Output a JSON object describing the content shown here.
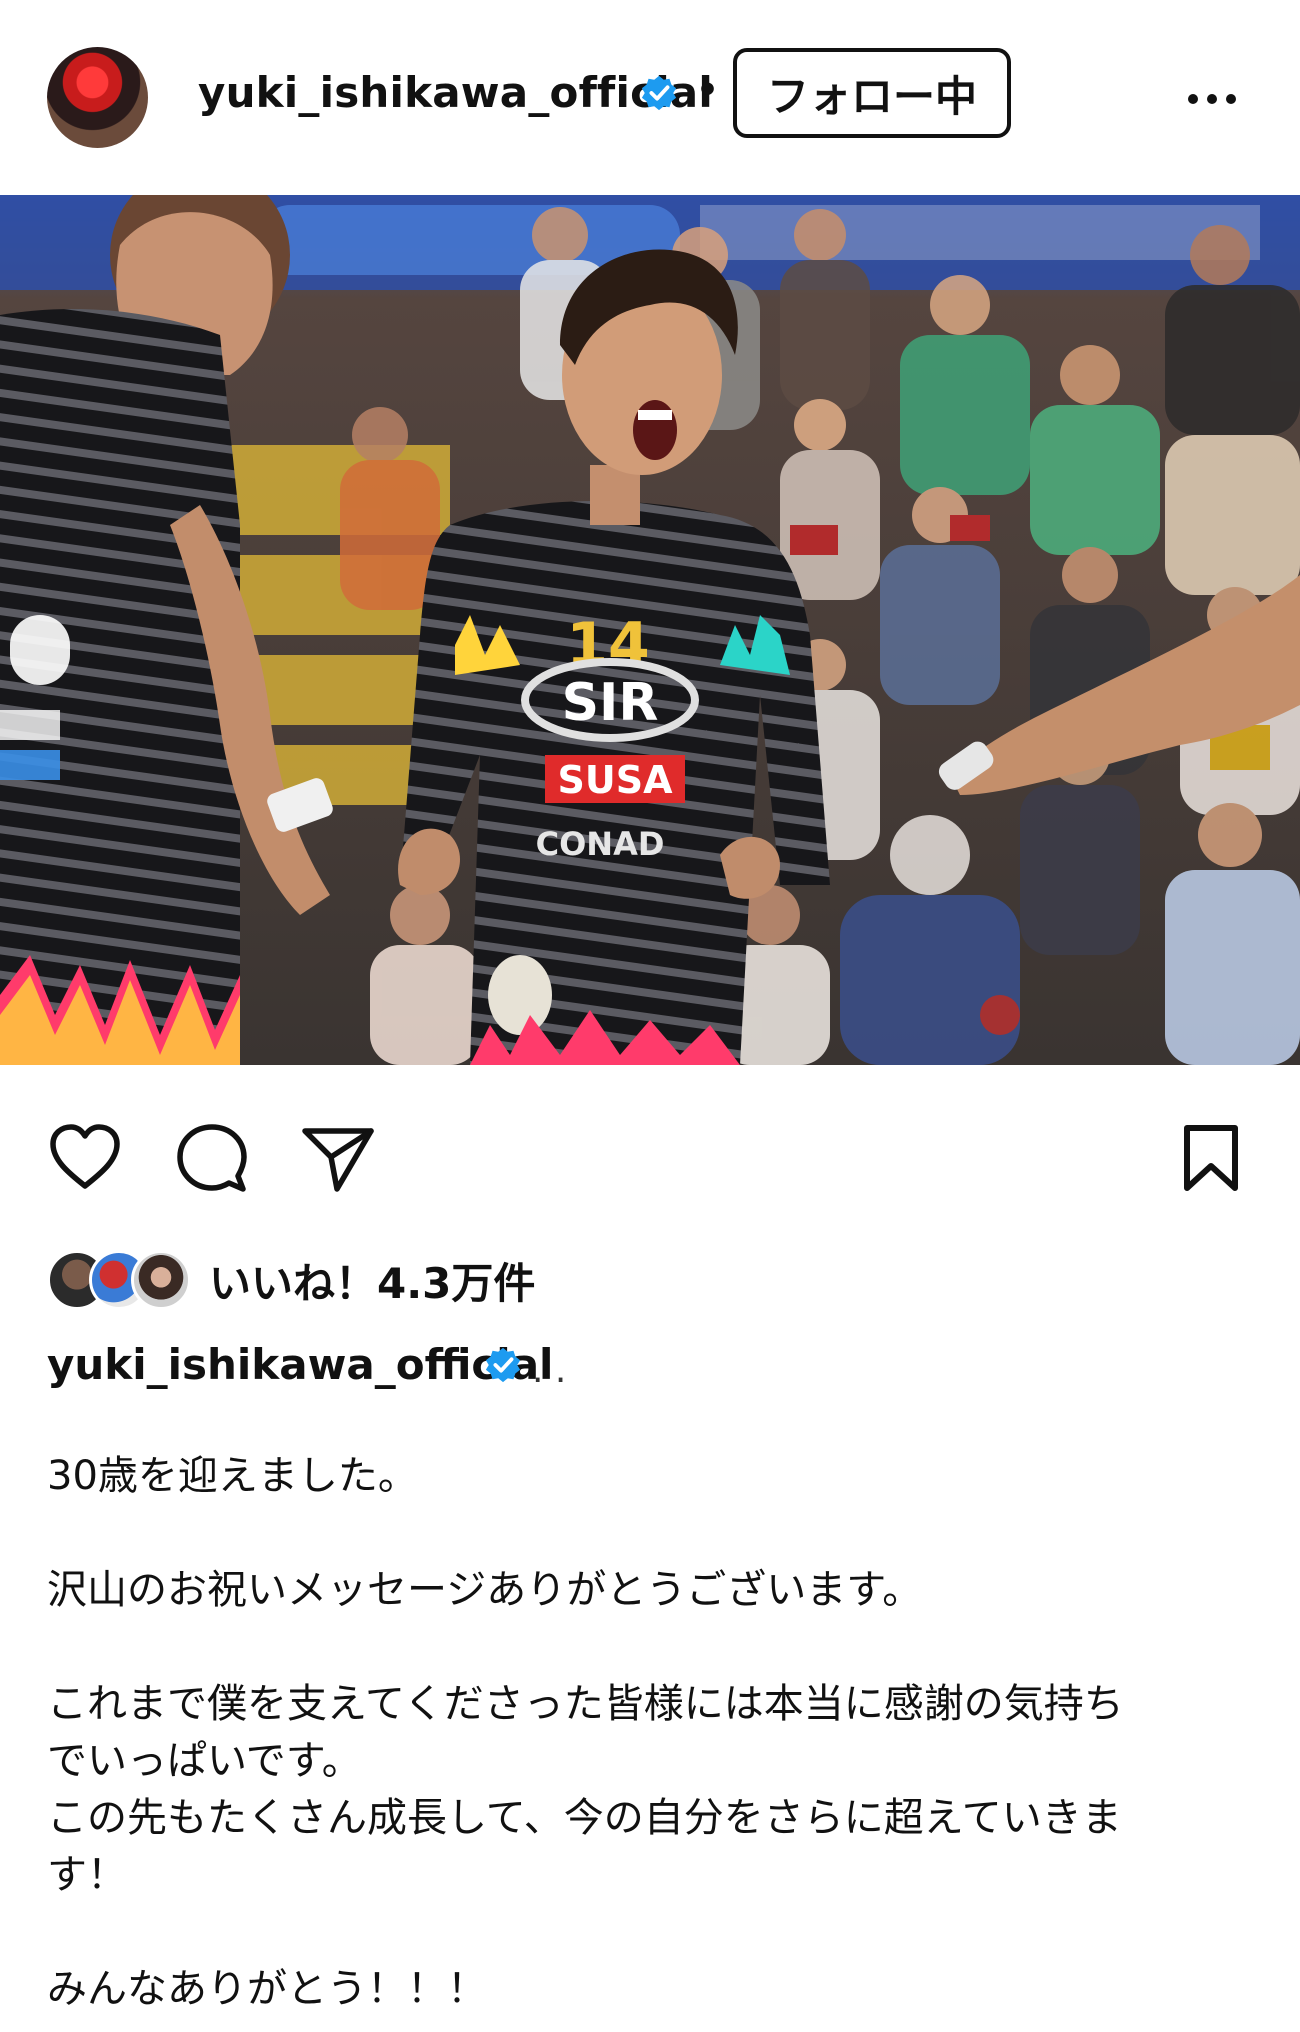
{
  "header": {
    "username": "yuki_ishikawa_official",
    "dot": "•",
    "follow_label": "フォロー中"
  },
  "icons": {
    "avatar": "profile-avatar",
    "verified": "verified-badge-icon",
    "more": "more-options-icon",
    "like": "heart-icon",
    "comment": "comment-icon",
    "share": "send-icon",
    "save": "bookmark-icon"
  },
  "likes": {
    "text": "いいね！4.3万件"
  },
  "caption": {
    "username": "yuki_ishikawa_official",
    "more": ". .",
    "lines": [
      "30歳を迎えました。",
      "",
      "沢山のお祝いメッセージありがとうございます。",
      "",
      "これまで僕を支えてくださった皆様には本当に感謝の気持ち",
      "でいっぱいです。",
      "この先もたくさん成長して、今の自分をさらに超えていきま",
      "す！",
      "",
      "みんなありがとう！！！"
    ]
  },
  "photo": {
    "jersey_number": "14",
    "sponsor_main": "SIR",
    "sponsor_second": "SUSA",
    "sponsor_third": "CONAD"
  },
  "colors": {
    "verified": "#1d9bf0",
    "text": "#111111",
    "background": "#ffffff"
  }
}
